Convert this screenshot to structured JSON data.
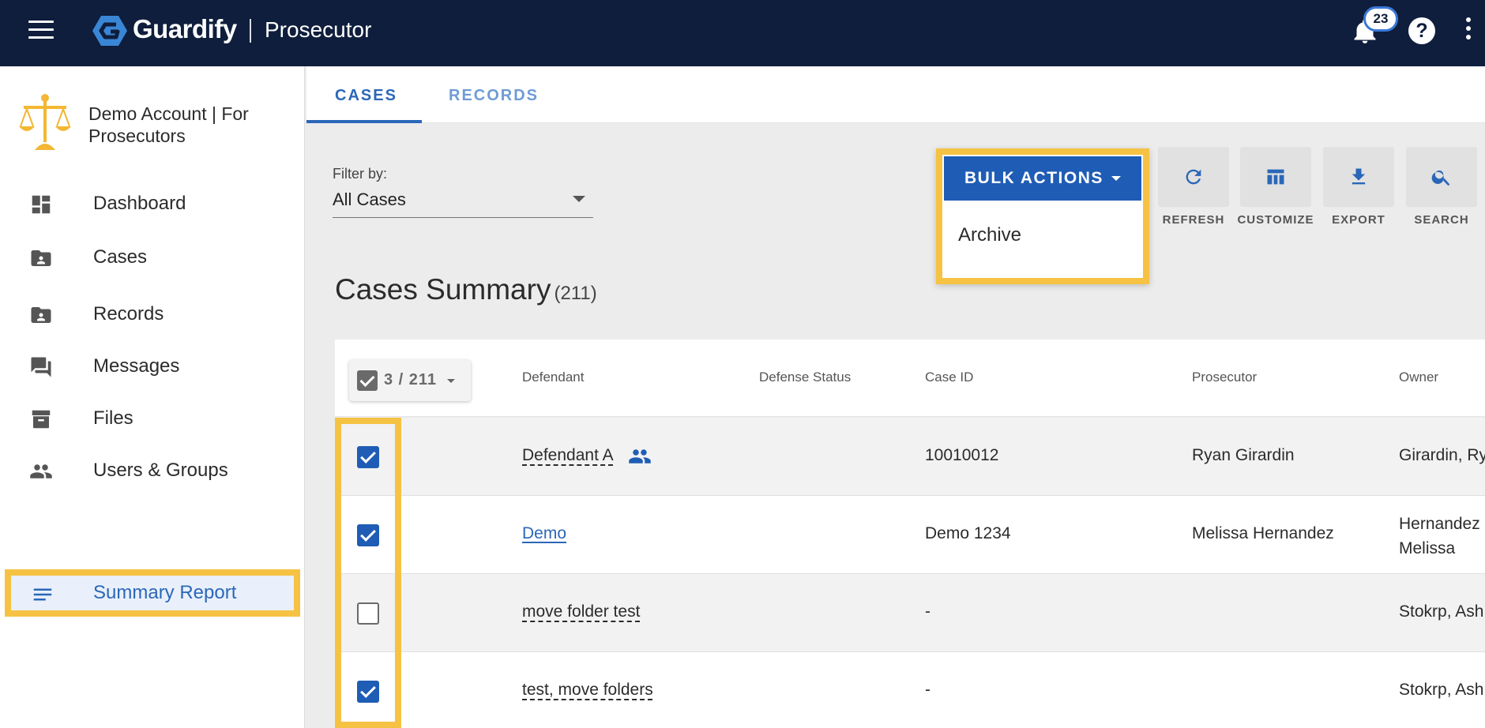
{
  "header": {
    "brand": "Guardify",
    "product": "Prosecutor",
    "notifications_count": "23",
    "help_symbol": "?"
  },
  "sidebar": {
    "account_name": "Demo Account | For Prosecutors",
    "items": [
      {
        "label": "Dashboard",
        "icon": "dashboard-icon"
      },
      {
        "label": "Cases",
        "icon": "folder-user-icon"
      },
      {
        "label": "Records",
        "icon": "folder-user-icon"
      },
      {
        "label": "Messages",
        "icon": "messages-icon"
      },
      {
        "label": "Files",
        "icon": "archive-box-icon"
      },
      {
        "label": "Users & Groups",
        "icon": "people-icon"
      },
      {
        "label": "Summary Report",
        "icon": "lines-icon",
        "active": true
      }
    ]
  },
  "tabs": [
    {
      "label": "CASES",
      "active": true
    },
    {
      "label": "RECORDS",
      "active": false
    }
  ],
  "filter": {
    "label": "Filter by:",
    "value": "All Cases"
  },
  "bulk_actions": {
    "label": "BULK ACTIONS",
    "menu_items": [
      "Archive"
    ]
  },
  "tools": [
    {
      "label": "REFRESH",
      "icon": "refresh-icon"
    },
    {
      "label": "CUSTOMIZE",
      "icon": "table-columns-icon"
    },
    {
      "label": "EXPORT",
      "icon": "download-icon"
    },
    {
      "label": "SEARCH",
      "icon": "search-icon"
    }
  ],
  "summary": {
    "title": "Cases Summary",
    "count": "(211)"
  },
  "table": {
    "selection": "3 / 211",
    "columns": [
      "Defendant",
      "Defense Status",
      "Case ID",
      "Prosecutor",
      "Owner"
    ],
    "rows": [
      {
        "checked": true,
        "defendant": "Defendant A",
        "defense_status": "",
        "case_id": "10010012",
        "prosecutor": "Ryan Girardin",
        "owner": "Girardin, Ry",
        "group_icon": true
      },
      {
        "checked": true,
        "defendant": "Demo",
        "defense_status": "",
        "case_id": "Demo 1234",
        "prosecutor": "Melissa Hernandez",
        "owner": "Hernandez, Melissa",
        "group_icon": false
      },
      {
        "checked": false,
        "defendant": "move folder test",
        "defense_status": "",
        "case_id": "-",
        "prosecutor": "",
        "owner": "Stokrp, Ash",
        "group_icon": false
      },
      {
        "checked": true,
        "defendant": "test, move folders",
        "defense_status": "",
        "case_id": "-",
        "prosecutor": "",
        "owner": "Stokrp, Ash",
        "group_icon": false
      }
    ]
  },
  "colors": {
    "topbar": "#0f1e3c",
    "primary": "#1f5cb5",
    "highlight": "#f6c244",
    "logo_blue": "#3a86d6",
    "scale_gold": "#f3b733"
  }
}
